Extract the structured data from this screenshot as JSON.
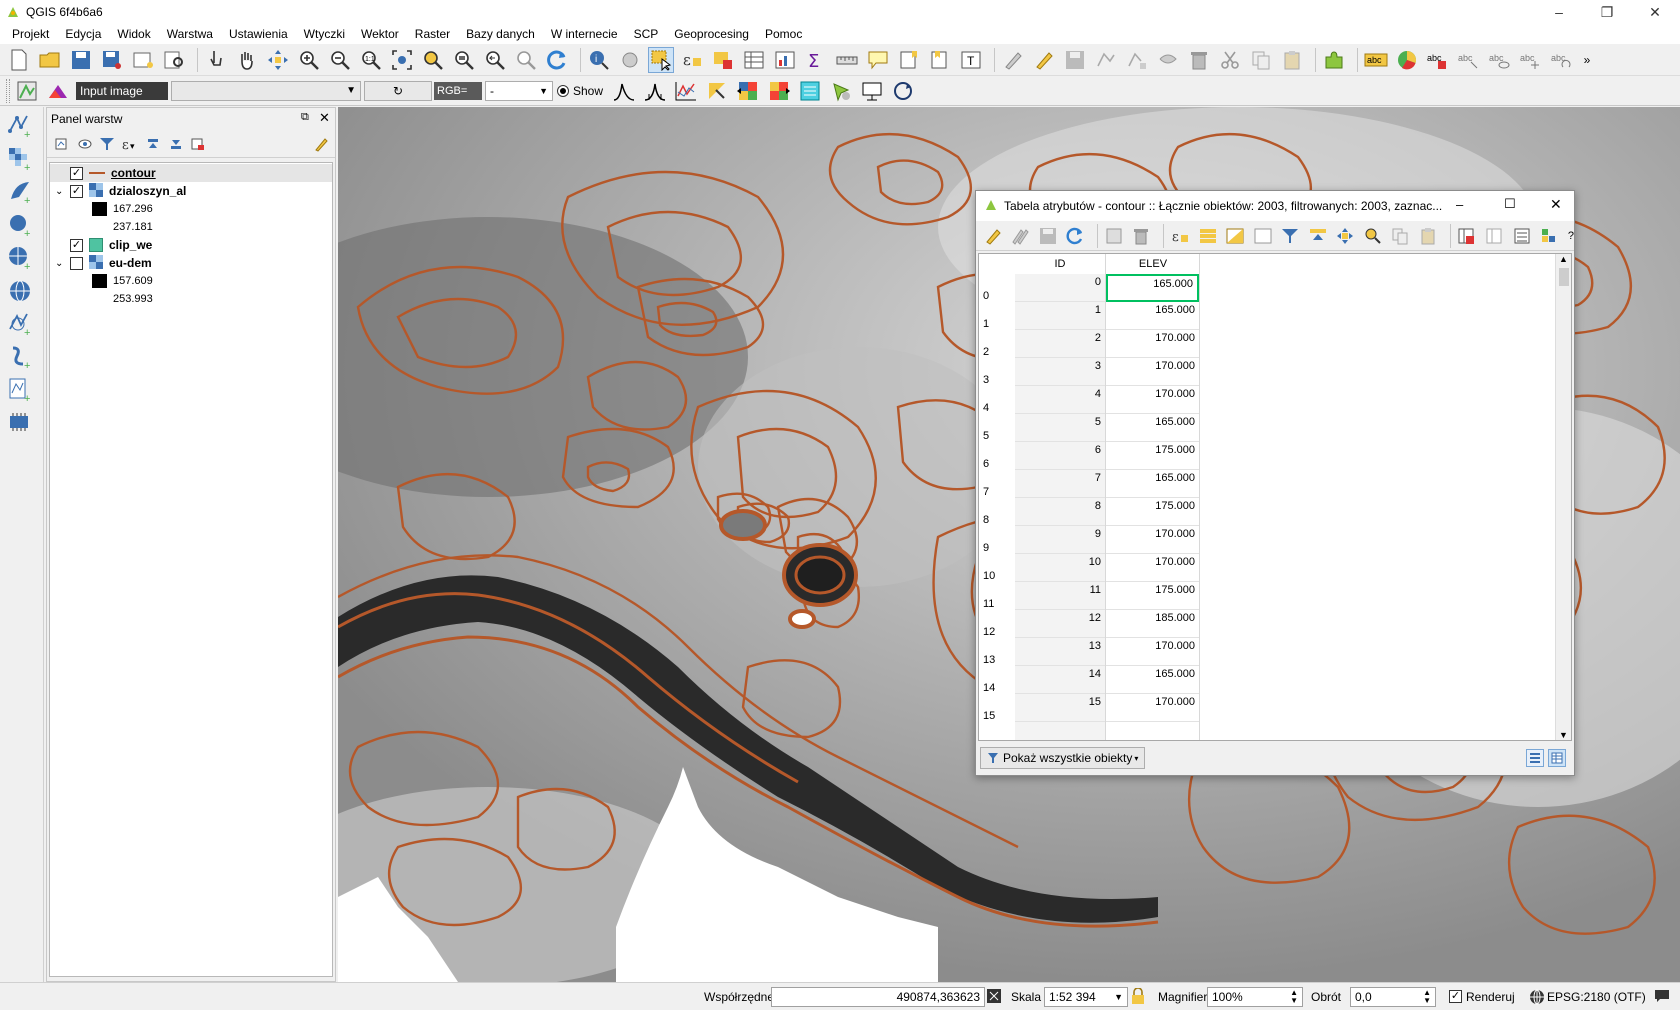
{
  "window": {
    "title": "QGIS 6f4b6a6",
    "controls": {
      "minimize": "–",
      "maximize": "❐",
      "close": "✕"
    }
  },
  "menu": [
    "Projekt",
    "Edycja",
    "Widok",
    "Warstwa",
    "Ustawienia",
    "Wtyczki",
    "Wektor",
    "Raster",
    "Bazy danych",
    "W internecie",
    "SCP",
    "Geoprocesing",
    "Pomoc"
  ],
  "scp_toolbar": {
    "input_label": "Input image",
    "rgb_label": "RGB=",
    "rgb_value": "-",
    "show_label": "Show"
  },
  "layers_panel": {
    "title": "Panel warstw",
    "layers": [
      {
        "name": "contour",
        "checked": true,
        "type": "line"
      },
      {
        "name": "dzialoszyn_al",
        "checked": true,
        "type": "raster",
        "min": "167.296",
        "max": "237.181"
      },
      {
        "name": "clip_we",
        "checked": true,
        "type": "polygon"
      },
      {
        "name": "eu-dem",
        "checked": false,
        "type": "raster",
        "min": "157.609",
        "max": "253.993"
      }
    ]
  },
  "attribute_table": {
    "title": "Tabela atrybutów - contour :: Łącznie obiektów: 2003, filtrowanych: 2003, zaznac...",
    "columns": [
      "ID",
      "ELEV"
    ],
    "row_headers": [
      "0",
      "1",
      "2",
      "3",
      "4",
      "5",
      "6",
      "7",
      "8",
      "9",
      "10",
      "11",
      "12",
      "13",
      "14",
      "15"
    ],
    "rows": [
      [
        "0",
        "165.000"
      ],
      [
        "1",
        "165.000"
      ],
      [
        "2",
        "170.000"
      ],
      [
        "3",
        "170.000"
      ],
      [
        "4",
        "170.000"
      ],
      [
        "5",
        "165.000"
      ],
      [
        "6",
        "175.000"
      ],
      [
        "7",
        "165.000"
      ],
      [
        "8",
        "175.000"
      ],
      [
        "9",
        "170.000"
      ],
      [
        "10",
        "170.000"
      ],
      [
        "11",
        "175.000"
      ],
      [
        "12",
        "185.000"
      ],
      [
        "13",
        "170.000"
      ],
      [
        "14",
        "165.000"
      ],
      [
        "15",
        "170.000"
      ]
    ],
    "filter_button": "Pokaż wszystkie obiekty",
    "help": "?"
  },
  "statusbar": {
    "coords_label": "Współrzędne",
    "coords_value": "490874,363623",
    "scale_label": "Skala",
    "scale_value": "1:52 394",
    "magnifier_label": "Magnifier",
    "magnifier_value": "100%",
    "rotation_label": "Obrót",
    "rotation_value": "0,0",
    "render_label": "Renderuj",
    "crs": "EPSG:2180 (OTF)"
  },
  "colors": {
    "contour": "#b5582a",
    "accent_select": "#00c060"
  }
}
